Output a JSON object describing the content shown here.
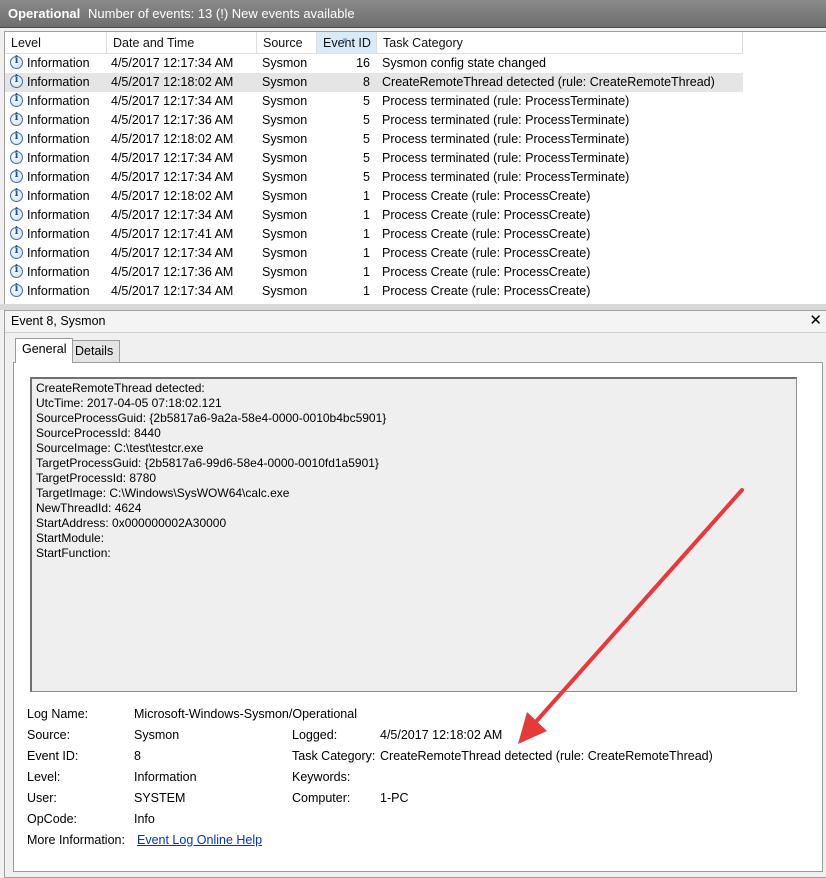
{
  "header": {
    "title": "Operational",
    "summary": "Number of events: 13 (!) New events available"
  },
  "columns": [
    "Level",
    "Date and Time",
    "Source",
    "Event ID",
    "Task Category"
  ],
  "events": [
    {
      "level": "Information",
      "datetime": "4/5/2017 12:17:34 AM",
      "source": "Sysmon",
      "event_id": "16",
      "category": "Sysmon config state changed"
    },
    {
      "level": "Information",
      "datetime": "4/5/2017 12:18:02 AM",
      "source": "Sysmon",
      "event_id": "8",
      "category": "CreateRemoteThread detected (rule: CreateRemoteThread)"
    },
    {
      "level": "Information",
      "datetime": "4/5/2017 12:17:34 AM",
      "source": "Sysmon",
      "event_id": "5",
      "category": "Process terminated (rule: ProcessTerminate)"
    },
    {
      "level": "Information",
      "datetime": "4/5/2017 12:17:36 AM",
      "source": "Sysmon",
      "event_id": "5",
      "category": "Process terminated (rule: ProcessTerminate)"
    },
    {
      "level": "Information",
      "datetime": "4/5/2017 12:18:02 AM",
      "source": "Sysmon",
      "event_id": "5",
      "category": "Process terminated (rule: ProcessTerminate)"
    },
    {
      "level": "Information",
      "datetime": "4/5/2017 12:17:34 AM",
      "source": "Sysmon",
      "event_id": "5",
      "category": "Process terminated (rule: ProcessTerminate)"
    },
    {
      "level": "Information",
      "datetime": "4/5/2017 12:17:34 AM",
      "source": "Sysmon",
      "event_id": "5",
      "category": "Process terminated (rule: ProcessTerminate)"
    },
    {
      "level": "Information",
      "datetime": "4/5/2017 12:18:02 AM",
      "source": "Sysmon",
      "event_id": "1",
      "category": "Process Create (rule: ProcessCreate)"
    },
    {
      "level": "Information",
      "datetime": "4/5/2017 12:17:34 AM",
      "source": "Sysmon",
      "event_id": "1",
      "category": "Process Create (rule: ProcessCreate)"
    },
    {
      "level": "Information",
      "datetime": "4/5/2017 12:17:41 AM",
      "source": "Sysmon",
      "event_id": "1",
      "category": "Process Create (rule: ProcessCreate)"
    },
    {
      "level": "Information",
      "datetime": "4/5/2017 12:17:34 AM",
      "source": "Sysmon",
      "event_id": "1",
      "category": "Process Create (rule: ProcessCreate)"
    },
    {
      "level": "Information",
      "datetime": "4/5/2017 12:17:36 AM",
      "source": "Sysmon",
      "event_id": "1",
      "category": "Process Create (rule: ProcessCreate)"
    },
    {
      "level": "Information",
      "datetime": "4/5/2017 12:17:34 AM",
      "source": "Sysmon",
      "event_id": "1",
      "category": "Process Create (rule: ProcessCreate)"
    }
  ],
  "detail": {
    "title": "Event 8, Sysmon",
    "close_symbol": "✕",
    "tabs": [
      "General",
      "Details"
    ],
    "message_lines": [
      "CreateRemoteThread detected:",
      "UtcTime: 2017-04-05 07:18:02.121",
      "SourceProcessGuid: {2b5817a6-9a2a-58e4-0000-0010b4bc5901}",
      "SourceProcessId: 8440",
      "SourceImage: C:\\test\\testcr.exe",
      "TargetProcessGuid: {2b5817a6-99d6-58e4-0000-0010fd1a5901}",
      "TargetProcessId: 8780",
      "TargetImage: C:\\Windows\\SysWOW64\\calc.exe",
      "NewThreadId: 4624",
      "StartAddress: 0x000000002A30000",
      "StartModule:",
      "StartFunction:"
    ],
    "fields": {
      "log_name_label": "Log Name:",
      "log_name": "Microsoft-Windows-Sysmon/Operational",
      "source_label": "Source:",
      "source": "Sysmon",
      "logged_label": "Logged:",
      "logged": "4/5/2017 12:18:02 AM",
      "event_id_label": "Event ID:",
      "event_id": "8",
      "task_category_label": "Task Category:",
      "task_category": "CreateRemoteThread detected (rule: CreateRemoteThread)",
      "level_label": "Level:",
      "level": "Information",
      "keywords_label": "Keywords:",
      "keywords": "",
      "user_label": "User:",
      "user": "SYSTEM",
      "computer_label": "Computer:",
      "computer": "1-PC",
      "opcode_label": "OpCode:",
      "opcode": "Info",
      "more_info_label": "More Information:",
      "more_info_link": "Event Log Online Help"
    }
  },
  "colors": {
    "annotation_arrow": "#e8393a",
    "selected_row": "#e5e5e5",
    "link": "#0033cc"
  }
}
